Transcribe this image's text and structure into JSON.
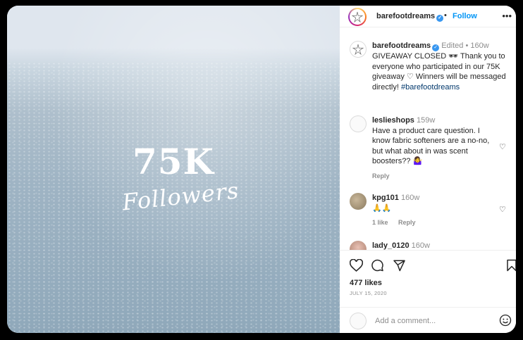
{
  "photo": {
    "title": "75K",
    "subtitle": "Followers"
  },
  "header": {
    "username": "barefootdreams",
    "separator": "•",
    "follow_label": "Follow",
    "more_label": "•••"
  },
  "caption": {
    "username": "barefootdreams",
    "edited": "Edited",
    "separator": "•",
    "age": "160w",
    "text": "GIVEAWAY CLOSED 🕶 Thank you to everyone who participated in our 75K giveaway ♡ Winners will be messaged directly!",
    "hashtag": "#barefootdreams"
  },
  "comments": [
    {
      "username": "leslieshops",
      "age": "159w",
      "text": "Have a product care question. I know fabric softeners are a no-no, but what about in was scent boosters?? 🤷‍♀️",
      "reply_label": "Reply"
    },
    {
      "username": "kpg101",
      "age": "160w",
      "text": "🙏🙏",
      "likes_label": "1 like",
      "reply_label": "Reply"
    },
    {
      "username": "lady_0120",
      "age": "160w"
    }
  ],
  "actions": {
    "likes": "477 likes",
    "date": "JULY 15, 2020",
    "comment_placeholder": "Add a comment..."
  },
  "colors": {
    "link": "#0095f6",
    "hashtag": "#00376b",
    "verified": "#3897f0",
    "muted": "#8e8e8e"
  }
}
